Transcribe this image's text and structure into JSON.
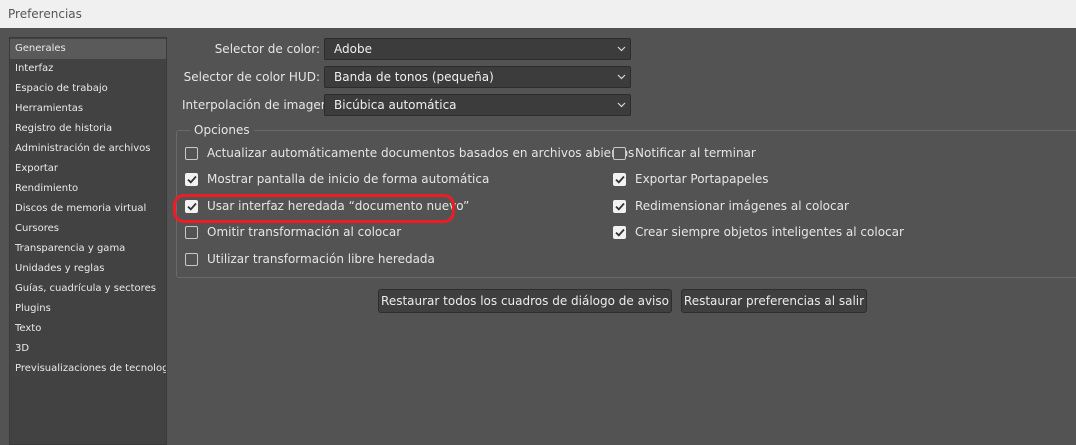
{
  "window": {
    "title": "Preferencias"
  },
  "sidebar": {
    "items": [
      {
        "label": "Generales",
        "selected": true
      },
      {
        "label": "Interfaz"
      },
      {
        "label": "Espacio de trabajo"
      },
      {
        "label": "Herramientas"
      },
      {
        "label": "Registro de historia"
      },
      {
        "label": "Administración de archivos"
      },
      {
        "label": "Exportar"
      },
      {
        "label": "Rendimiento"
      },
      {
        "label": "Discos de memoria virtual"
      },
      {
        "label": "Cursores"
      },
      {
        "label": "Transparencia y gama"
      },
      {
        "label": "Unidades y reglas"
      },
      {
        "label": "Guías, cuadrícula y sectores"
      },
      {
        "label": "Plugins"
      },
      {
        "label": "Texto"
      },
      {
        "label": "3D"
      },
      {
        "label": "Previsualizaciones de tecnología"
      }
    ]
  },
  "settings": {
    "color_picker": {
      "label": "Selector de color:",
      "value": "Adobe"
    },
    "hud_picker": {
      "label": "Selector de color HUD:",
      "value": "Banda de tonos (pequeña)"
    },
    "interpolation": {
      "label": "Interpolación de imagen:",
      "value": "Bicúbica automática"
    }
  },
  "options": {
    "legend": "Opciones",
    "left": [
      {
        "label": "Actualizar automáticamente documentos basados en archivos abiertos",
        "checked": false
      },
      {
        "label": "Mostrar pantalla de inicio de forma automática",
        "checked": true
      },
      {
        "label": "Usar interfaz heredada “documento nuevo”",
        "checked": true
      },
      {
        "label": "Omitir transformación al colocar",
        "checked": false
      },
      {
        "label": "Utilizar transformación libre heredada",
        "checked": false
      }
    ],
    "right": [
      {
        "label": "Notificar al terminar",
        "checked": false
      },
      {
        "label": "Exportar Portapapeles",
        "checked": true
      },
      {
        "label": "Redimensionar imágenes al colocar",
        "checked": true
      },
      {
        "label": "Crear siempre objetos inteligentes al colocar",
        "checked": true
      }
    ]
  },
  "buttons": {
    "reset_dialogs": "Restaurar todos los cuadros de diálogo de aviso",
    "reset_prefs": "Restaurar preferencias al salir"
  },
  "colors": {
    "background": "#535353",
    "sidebar": "#424242",
    "highlight": "#ee1c25"
  }
}
